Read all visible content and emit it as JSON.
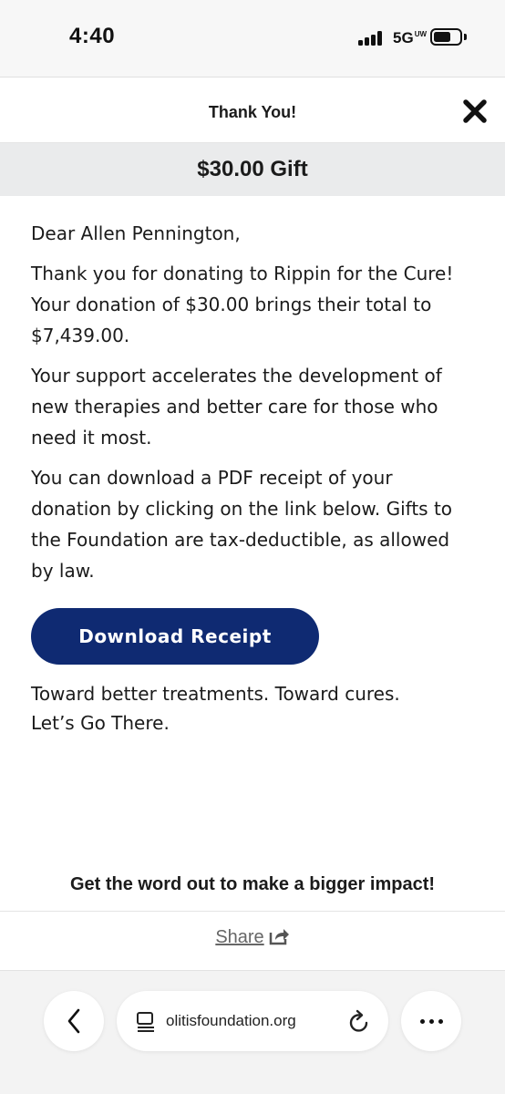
{
  "status_bar": {
    "time": "4:40",
    "network": "5G",
    "network_suffix": "UW"
  },
  "modal": {
    "title": "Thank You!",
    "gift_amount": "$30.00 Gift",
    "greeting": "Dear Allen Pennington,",
    "paragraph_1": "Thank you for donating to Rippin for the Cure! Your donation of $30.00 brings their total to $7,439.00.",
    "paragraph_2": "Your support accelerates the development of new therapies and better care for those who need it most.",
    "paragraph_3": "You can download a PDF receipt of your donation by clicking on the link below. Gifts to the Foundation are tax-deductible, as allowed by law.",
    "download_button": "Download Receipt",
    "closing_line_1": "Toward better treatments. Toward cures.",
    "closing_line_2": "Let’s Go There.",
    "share_heading": "Get the word out to make a bigger impact!",
    "share_link": "Share"
  },
  "browser": {
    "url": "olitisfoundation.org"
  },
  "colors": {
    "button_bg": "#0f2a72",
    "gift_bar_bg": "#eaebec"
  },
  "icons": [
    "signal-icon",
    "battery-icon",
    "close-icon",
    "share-icon",
    "back-icon",
    "reader-icon",
    "reload-icon",
    "more-icon"
  ]
}
